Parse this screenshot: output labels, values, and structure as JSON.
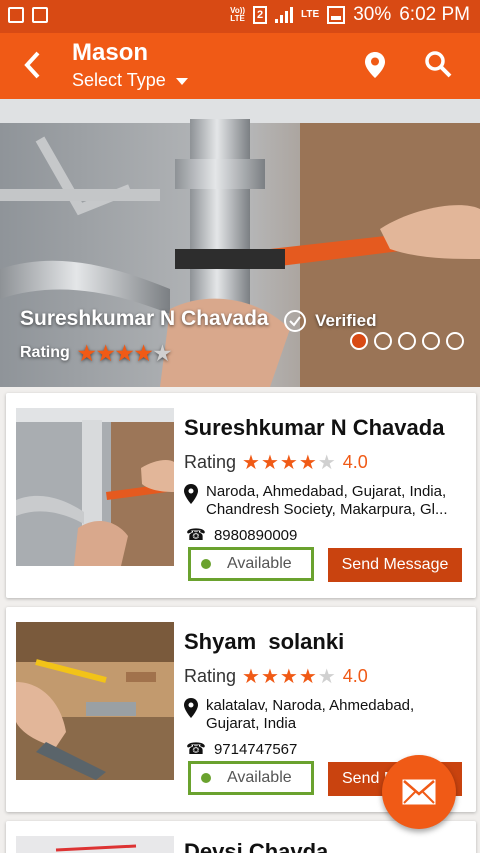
{
  "status_bar": {
    "volte": "Vo))\nLTE",
    "sim": "2",
    "lte_label": "LTE",
    "battery": "30%",
    "time": "6:02 PM"
  },
  "app_bar": {
    "title": "Mason",
    "subtitle": "Select Type",
    "back_icon": "back-arrow-icon",
    "location_icon": "map-pin-icon",
    "search_icon": "search-icon"
  },
  "hero": {
    "name": "Sureshkumar N Chavada",
    "verified_label": "Verified",
    "rating_label": "Rating",
    "stars": 4,
    "stars_max": 5,
    "slide_count": 5,
    "active_slide": 0
  },
  "listings": [
    {
      "name": "Sureshkumar N Chavada",
      "rating_label": "Rating",
      "stars": 4,
      "rating_value": "4.0",
      "address": "Naroda, Ahmedabad, Gujarat, India, Chandresh Society, Makarpura, Gl...",
      "phone": "8980890009",
      "status": "Available",
      "action": "Send Message"
    },
    {
      "name": "Shyam  solanki",
      "rating_label": "Rating",
      "stars": 4,
      "rating_value": "4.0",
      "address": "kalatalav, Naroda, Ahmedabad, Gujarat, India",
      "phone": "9714747567",
      "status": "Available",
      "action": "Send Message"
    },
    {
      "name": "Devsi  Chavda"
    }
  ],
  "colors": {
    "primary": "#f05a16",
    "status_bar": "#d84a14",
    "button": "#c9430f",
    "available": "#6aa22e"
  }
}
